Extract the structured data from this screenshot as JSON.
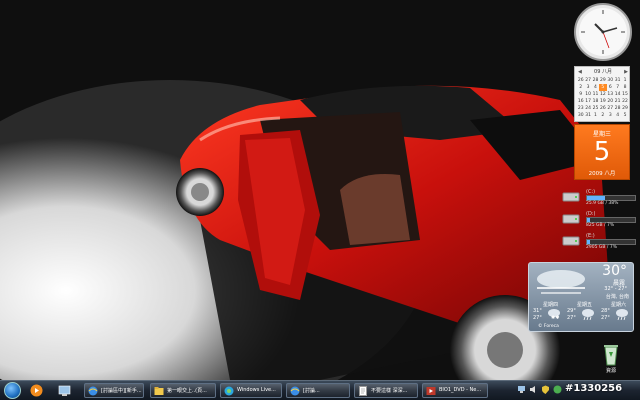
{
  "calendar": {
    "month_label": "09 八月",
    "weekday_label": "星期三",
    "day": "5",
    "year_month": "2009 八月",
    "grid": [
      [
        "26",
        "27",
        "28",
        "29",
        "30",
        "31",
        "1"
      ],
      [
        "2",
        "3",
        "4",
        "5",
        "6",
        "7",
        "8"
      ],
      [
        "9",
        "10",
        "11",
        "12",
        "13",
        "14",
        "15"
      ],
      [
        "16",
        "17",
        "18",
        "19",
        "20",
        "21",
        "22"
      ],
      [
        "23",
        "24",
        "25",
        "26",
        "27",
        "28",
        "29"
      ],
      [
        "30",
        "31",
        "1",
        "2",
        "3",
        "4",
        "5"
      ]
    ],
    "today": "5"
  },
  "drives": [
    {
      "name": "(C:)",
      "info": "25.9 GB / 38%",
      "used": 0.38
    },
    {
      "name": "(D:)",
      "info": "825 GB / 7%",
      "used": 0.07
    },
    {
      "name": "(E:)",
      "info": "2905 GB / 7%",
      "used": 0.07
    }
  ],
  "weather": {
    "temp": "30°",
    "condition": "晨霧",
    "range": "32° - 27°",
    "city": "台灣, 台南",
    "forecast": [
      {
        "day": "星期四",
        "hi": "31°",
        "lo": "27°"
      },
      {
        "day": "星期五",
        "hi": "29°",
        "lo": "27°"
      },
      {
        "day": "星期六",
        "hi": "28°",
        "lo": "27°"
      }
    ],
    "credit": "© Foreca"
  },
  "recycle_bin": {
    "label": "資源"
  },
  "taskbar": {
    "buttons": [
      {
        "label": "[討論區中][新手..."
      },
      {
        "label": "第一眼交上..(頁..."
      },
      {
        "label": "Windows Live..."
      },
      {
        "label": "[討論..."
      },
      {
        "label": "不要這樣 深深..."
      },
      {
        "label": "BIO1_DVD - Ne..."
      }
    ]
  },
  "watermark": "#1330256",
  "colors": {
    "accent": "#e0600a",
    "car": "#c8100c"
  }
}
